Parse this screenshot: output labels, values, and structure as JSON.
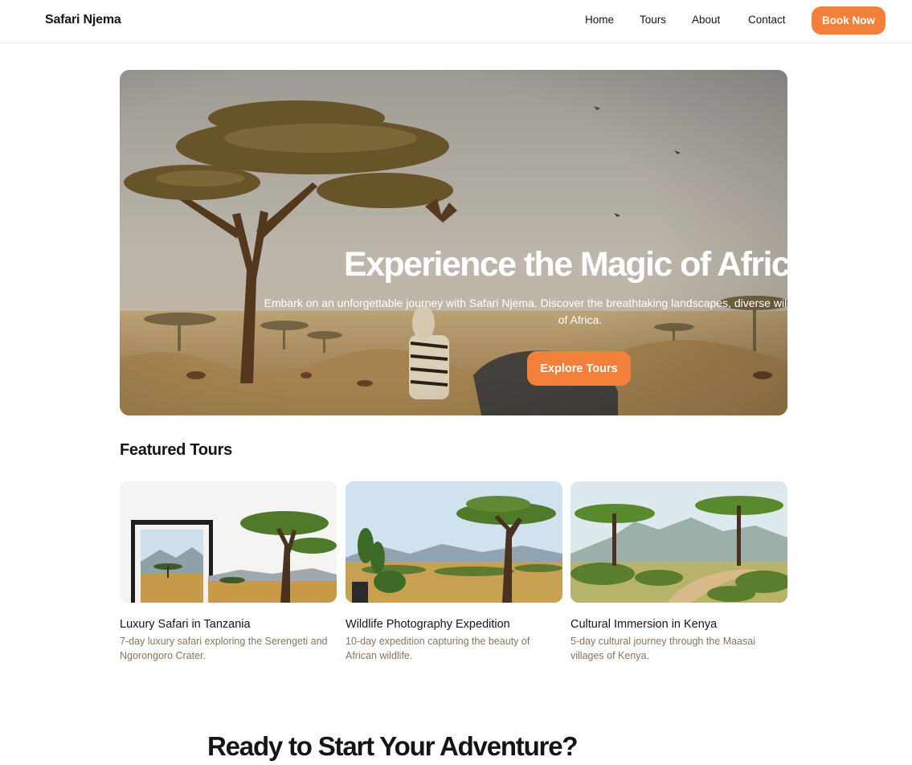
{
  "header": {
    "brand": "Safari Njema",
    "nav": {
      "home": "Home",
      "tours": "Tours",
      "about": "About",
      "contact": "Contact"
    },
    "book_label": "Book Now"
  },
  "hero": {
    "title": "Experience the Magic of Africa",
    "subtitle": "Embark on an unforgettable journey with Safari Njema. Discover the breathtaking landscapes, diverse wildlife, and rich cultures of Africa.",
    "button_label": "Explore Tours"
  },
  "featured": {
    "title": "Featured Tours",
    "tours": [
      {
        "title": "Luxury Safari in Tanzania",
        "description": "7-day luxury safari exploring the Serengeti and Ngorongoro Crater."
      },
      {
        "title": "Wildlife Photography Expedition",
        "description": "10-day expedition capturing the beauty of African wildlife."
      },
      {
        "title": "Cultural Immersion in Kenya",
        "description": "5-day cultural journey through the Maasai villages of Kenya."
      }
    ]
  },
  "cta": {
    "title": "Ready to Start Your Adventure?"
  },
  "colors": {
    "accent": "#f2803a",
    "text": "#181411",
    "muted": "#8a7260"
  }
}
